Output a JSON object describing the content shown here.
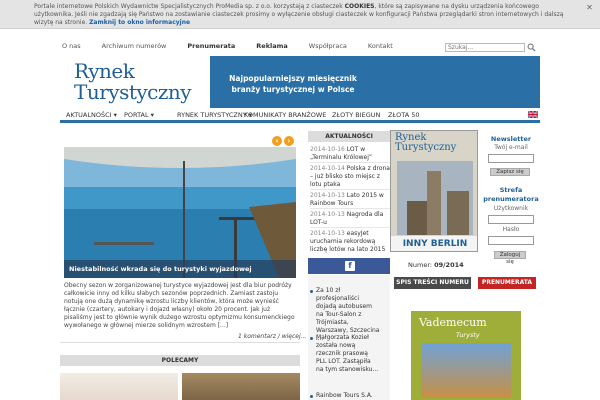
{
  "cookie": {
    "text_before": "Portale internetowe Polskich Wydawnictw Specjalistycznych ProMedia sp. z o.o. korzystają z ciasteczek ",
    "text_bold": "COOKIES",
    "text_after": ", które są zapisywane na dysku urządzenia końcowego użytkownika. Jeśli nie zgadzają się Państwo na zostawianie ciasteczek prosimy o wyłączenie obsługi ciasteczek w konfiguracji Państwa przeglądarki stron internetowych i dalszą wizytę na stronie. ",
    "close_link": "Zamknij to okno informacyjne",
    "close_icon": "✕"
  },
  "topnav": {
    "items": [
      "O nas",
      "Archiwum numerów",
      "Prenumerata",
      "Reklama",
      "Współpraca",
      "Kontakt"
    ],
    "search_placeholder": "Szukaj..."
  },
  "banner": {
    "logo_line1": "Rynek",
    "logo_line2": "Turystyczny",
    "slogan_line1": "Najpopularniejszy miesięcznik",
    "slogan_line2": "branży turystycznej w Polsce"
  },
  "menu": {
    "items": [
      "AKTUALNOŚCI ▾",
      "PORTAL ▾",
      "RYNEK TURYSTYCZNY ▾",
      "KOMUNIKATY BRANŻOWE",
      "ZŁOTY BIEGUN",
      "ZŁOTA 50"
    ]
  },
  "slider": {
    "prev": "‹",
    "next": "›",
    "caption": "Niestabilność wkrada się do turystyki wyjazdowej",
    "excerpt": "Obecny sezon w zorganizowanej turystyce wyjazdowej jest dla biur podróży całkowicie inny od kilku słabych sezonów poprzednich. Zamiast zastoju notują one dużą dynamikę wzrostu liczby klientów, która może wynieść łącznie (czartery, autokary i dojazd własny) około 20 procent. Jak już pisaliśmy jest to głównie wynik dużego wzrostu optymizmu konsumenckiego wywołanego w głównej mierze solidnym wzrostem [...]",
    "more": "1 komentarz / więcej..."
  },
  "polecamy": {
    "title": "POLECAMY"
  },
  "news": {
    "title": "AKTUALNOŚCI",
    "items": [
      {
        "date": "2014-10-16",
        "text": "LOT w „Terminalu Królowej”"
      },
      {
        "date": "2014-10-14",
        "text": "Polska z drona – już blisko sto miejsc z lotu ptaka"
      },
      {
        "date": "2014-10-13",
        "text": "Lato 2015 w Rainbow Tours"
      },
      {
        "date": "2014-10-13",
        "text": "Nagroda dla LOT-u"
      },
      {
        "date": "2014-10-13",
        "text": "easyJet uruchamia rekordową liczbę lotów na lato 2015"
      }
    ]
  },
  "facebook": {
    "icon": "f",
    "page_name": "",
    "posts": [
      "Za 10 zł profesjonaliści dojadą autobusem na Tour-Salon z Trójmiasta, Warszawy, Szczecina i...",
      "Małgorzata Kozieł została nową rzecznik prasową PLL LOT. Zastąpiła na tym stanowisku...",
      "Rainbow Tours S.A."
    ]
  },
  "magazine": {
    "cover_title1": "Rynek",
    "cover_title2": "Turystyczny",
    "cover_city": "INNY BERLIN",
    "issue_label": "Numer: ",
    "issue_value": "09/2014",
    "toc_button": "SPIS TREŚCI NUMERU",
    "subscribe_button": "PRENUMERATA"
  },
  "vademecum": {
    "title": "Vademecum",
    "subtitle": "Turysty"
  },
  "newsletter": {
    "title": "Newsletter",
    "email_label": "Twój e-mail",
    "submit": "Zapisz się"
  },
  "subscriber": {
    "title_line1": "Strefa",
    "title_line2": "prenumeratora",
    "user_label": "Użytkownik",
    "pass_label": "Hasło",
    "submit": "Zaloguj się"
  },
  "colors": {
    "brand_blue": "#2a6fa6",
    "accent_orange": "#f0a020",
    "subscribe_red": "#c32424",
    "facebook": "#3b5998"
  }
}
